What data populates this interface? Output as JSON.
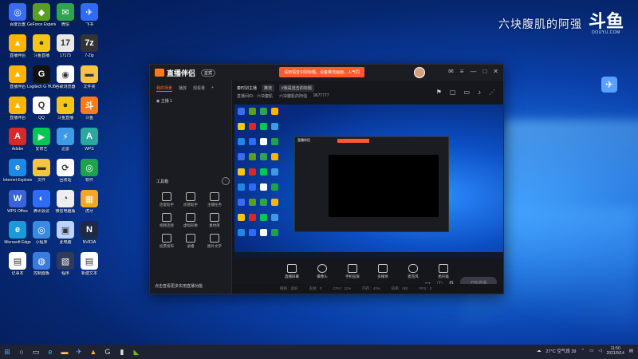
{
  "desktop": {
    "icons": [
      {
        "label": "百度云盘",
        "color": "#3b6cf0",
        "glyph": "◎"
      },
      {
        "label": "GeForce Experience",
        "color": "#5a9e24",
        "glyph": "◆"
      },
      {
        "label": "微信",
        "color": "#2ea44f",
        "glyph": "✉"
      },
      {
        "label": "飞书",
        "color": "#2f6cf5",
        "glyph": "✈"
      },
      {
        "label": "直播伴侣",
        "color": "#ffb400",
        "glyph": "▲"
      },
      {
        "label": "斗鱼直播",
        "color": "#f5c518",
        "glyph": "●"
      },
      {
        "label": "17173",
        "color": "#e8e8e8",
        "glyph": "17"
      },
      {
        "label": "7-Zip",
        "color": "#333333",
        "glyph": "7z"
      },
      {
        "label": "直播伴侣",
        "color": "#ffb400",
        "glyph": "▲"
      },
      {
        "label": "Logitech G HUB",
        "color": "#111111",
        "glyph": "G"
      },
      {
        "label": "谷歌浏览器",
        "color": "#ffffff",
        "glyph": "◉"
      },
      {
        "label": "文件夹",
        "color": "#f5c542",
        "glyph": "▬"
      },
      {
        "label": "直播伴侣",
        "color": "#ffb400",
        "glyph": "▲"
      },
      {
        "label": "QQ",
        "color": "#ffffff",
        "glyph": "Q"
      },
      {
        "label": "斗鱼直播",
        "color": "#f5c518",
        "glyph": "●"
      },
      {
        "label": "斗鱼",
        "color": "#ff7a1a",
        "glyph": "斗"
      },
      {
        "label": "Adobe",
        "color": "#d42a2a",
        "glyph": "A"
      },
      {
        "label": "爱奇艺",
        "color": "#00c853",
        "glyph": "▶"
      },
      {
        "label": "迅雷",
        "color": "#3f9ae6",
        "glyph": "⚡"
      },
      {
        "label": "WPS",
        "color": "#2ba7a0",
        "glyph": "A"
      },
      {
        "label": "Internet Explorer",
        "color": "#1e88e5",
        "glyph": "e"
      },
      {
        "label": "文件",
        "color": "#f5c542",
        "glyph": "▬"
      },
      {
        "label": "回收站",
        "color": "#ffffff",
        "glyph": "⟳"
      },
      {
        "label": "软件",
        "color": "#1fa34a",
        "glyph": "◎"
      },
      {
        "label": "WPS Office",
        "color": "#3a63d8",
        "glyph": "W"
      },
      {
        "label": "腾讯会议",
        "color": "#2f6cf5",
        "glyph": "◐"
      },
      {
        "label": "微信电脑版",
        "color": "#eeeeee",
        "glyph": "◔"
      },
      {
        "label": "虎牙",
        "color": "#f5a623",
        "glyph": "▦"
      },
      {
        "label": "Microsoft Edge",
        "color": "#1a9bd8",
        "glyph": "e"
      },
      {
        "label": "小程序",
        "color": "#3a8be0",
        "glyph": "◎"
      },
      {
        "label": "此电脑",
        "color": "#bcd4ff",
        "glyph": "▣"
      },
      {
        "label": "NVIDIA",
        "color": "#1f2a40",
        "glyph": "N"
      },
      {
        "label": "记事本",
        "color": "#ffffff",
        "glyph": "▤"
      },
      {
        "label": "控制面板",
        "color": "#3a7be0",
        "glyph": "◍"
      },
      {
        "label": "程序",
        "color": "#2f3b5c",
        "glyph": "▧"
      },
      {
        "label": "新建文本",
        "color": "#ffffff",
        "glyph": "▤"
      }
    ],
    "watermark_text": "六块腹肌的阿强",
    "watermark_logo": "斗鱼",
    "watermark_domain": "DOUYU.COM"
  },
  "app": {
    "name": "直播伴侣",
    "version": "正式",
    "notice": "请用语音识别标题，设备推流画面，人气同",
    "sidebar": {
      "tabs": [
        "我的场景",
        "播放",
        "观看量"
      ],
      "scene": "主播 1",
      "tools_title": "工具箱",
      "tools": [
        "连麦助手",
        "房管助手",
        "主播任务",
        "视频连接",
        "虚拟形象",
        "素材库",
        "投票发布",
        "录播",
        "图片文字"
      ],
      "note": "点击查看更多实用直播功能"
    },
    "main": {
      "info_line1": [
        "秦时别主播",
        "推流",
        "#我是连击的标题"
      ],
      "info_line2": [
        "直播间ID：六块腹肌",
        "六块腹肌的阿强",
        "9677777"
      ],
      "controls": [
        "直播屏幕",
        "摄像头",
        "手机投屏",
        "多媒体",
        "麦克风",
        "扬声器"
      ],
      "start_label": "开始直播",
      "status": [
        "网络：良好",
        "丢帧：0",
        "CPU：11%",
        "内存：43%",
        "码率：0kb",
        "FPS：0"
      ]
    }
  },
  "taskbar": {
    "weather": "27°C 空气良 39",
    "time": "11:50",
    "date": "2021/9/14"
  }
}
